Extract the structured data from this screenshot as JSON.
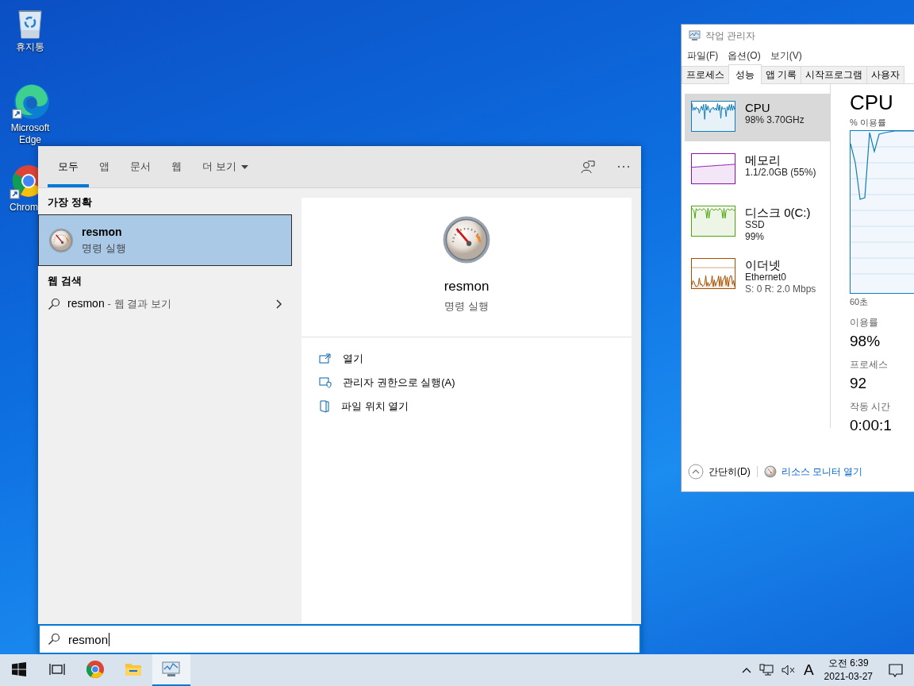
{
  "desktop_icons": [
    {
      "kind": "recycle_bin",
      "label": "휴지통"
    },
    {
      "kind": "edge",
      "label": "Microsoft Edge"
    },
    {
      "kind": "chrome",
      "label": "Chrom"
    }
  ],
  "task_manager": {
    "title": "작업 관리자",
    "menu": [
      "파일(F)",
      "옵션(O)",
      "보기(V)"
    ],
    "tabs": [
      {
        "label": "프로세스",
        "selected": false
      },
      {
        "label": "성능",
        "selected": true
      },
      {
        "label": "앱 기록",
        "selected": false
      },
      {
        "label": "시작프로그램",
        "selected": false
      },
      {
        "label": "사용자",
        "selected": false
      }
    ],
    "perf_items": [
      {
        "kind": "cpu",
        "name": "CPU",
        "details": [
          "98% 3.70GHz"
        ],
        "color": "#117dbb",
        "selected": true
      },
      {
        "kind": "memory",
        "name": "메모리",
        "details": [
          "1.1/2.0GB (55%)"
        ],
        "color": "#8b12ae",
        "selected": false
      },
      {
        "kind": "disk",
        "name": "디스크 0(C:)",
        "details": [
          "SSD",
          "99%"
        ],
        "color": "#4da60c",
        "selected": false
      },
      {
        "kind": "network",
        "name": "이더넷",
        "details": [
          "Ethernet0",
          "S: 0 R: 2.0 Mbps"
        ],
        "color": "#a74f01",
        "selected": false
      }
    ],
    "detail": {
      "title": "CPU",
      "chart_label": "% 이용률",
      "time_label": "60초",
      "stats": [
        {
          "label": "이용률",
          "value": "98%"
        },
        {
          "label": "프로세스",
          "value": "92"
        },
        {
          "label": "작동 시간",
          "value": "0:00:1"
        }
      ]
    },
    "footer": {
      "collapse": "간단히(D)",
      "link": "리소스 모니터 열기"
    }
  },
  "search": {
    "tabs": [
      {
        "label": "모두",
        "selected": true,
        "menu": false
      },
      {
        "label": "앱",
        "selected": false,
        "menu": false
      },
      {
        "label": "문서",
        "selected": false,
        "menu": false
      },
      {
        "label": "웹",
        "selected": false,
        "menu": false
      },
      {
        "label": "더 보기",
        "selected": false,
        "menu": true
      }
    ],
    "best_heading": "가장 정확",
    "best_match": {
      "title": "resmon",
      "subtitle": "명령 실행",
      "selected": true
    },
    "web_heading": "웹 검색",
    "web_result": {
      "query": "resmon",
      "suffix": "- 웹 결과 보기"
    },
    "preview": {
      "title": "resmon",
      "subtitle": "명령 실행"
    },
    "actions": [
      {
        "kind": "open",
        "label": "열기"
      },
      {
        "kind": "admin",
        "label": "관리자 권한으로 실행(A)"
      },
      {
        "kind": "folder",
        "label": "파일 위치 열기"
      }
    ],
    "query": "resmon"
  },
  "taskbar": {
    "apps": [
      {
        "kind": "start",
        "selected": false
      },
      {
        "kind": "taskview",
        "selected": false
      },
      {
        "kind": "chrome",
        "selected": false
      },
      {
        "kind": "explorer",
        "selected": false
      },
      {
        "kind": "taskmgr",
        "selected": true
      }
    ],
    "input_indicator": "A",
    "time": "오전 6:39",
    "date": "2021-03-27"
  }
}
